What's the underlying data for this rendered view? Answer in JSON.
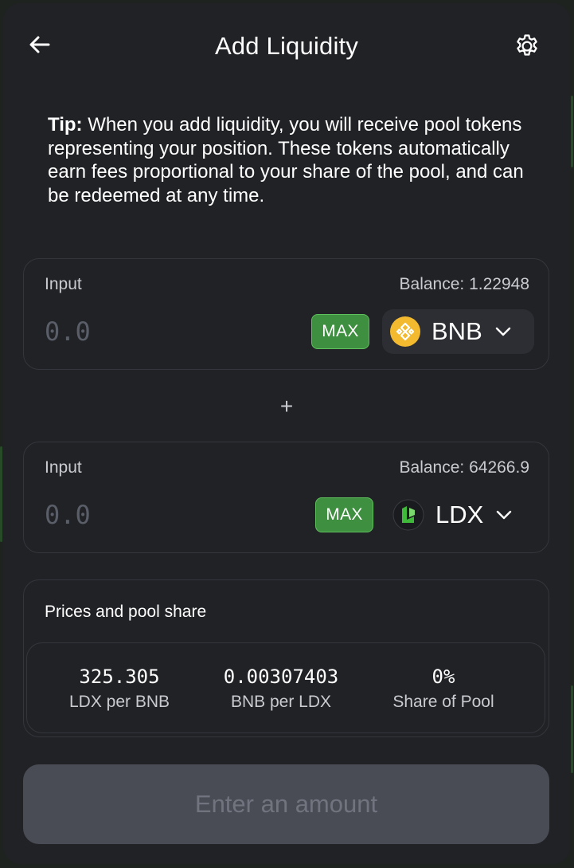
{
  "header": {
    "title": "Add Liquidity",
    "back_icon": "arrow-left-icon",
    "settings_icon": "gear-icon"
  },
  "tip": {
    "label": "Tip:",
    "text": " When you add liquidity, you will receive pool tokens representing your position. These tokens automatically earn fees proportional to your share of the pool, and can be redeemed at any time."
  },
  "input_a": {
    "label": "Input",
    "balance": "Balance: 1.22948",
    "placeholder": "0.0",
    "max_label": "MAX",
    "token": "BNB",
    "token_icon": "bnb-logo-icon"
  },
  "plus": "+",
  "input_b": {
    "label": "Input",
    "balance": "Balance: 64266.9",
    "placeholder": "0.0",
    "max_label": "MAX",
    "token": "LDX",
    "token_icon": "ldx-logo-icon"
  },
  "prices": {
    "title": "Prices and pool share",
    "items": [
      {
        "value": "325.305",
        "label": "LDX per BNB"
      },
      {
        "value": "0.00307403",
        "label": "BNB per LDX"
      },
      {
        "value": "0%",
        "label": "Share of Pool"
      }
    ]
  },
  "submit": {
    "label": "Enter an amount"
  },
  "colors": {
    "panel": "#212226",
    "border": "#33363c",
    "max_button": "#3e8f3f",
    "bnb": "#f3ba2f",
    "ldx": "#3fb93a",
    "disabled_button": "#4a4c55"
  }
}
